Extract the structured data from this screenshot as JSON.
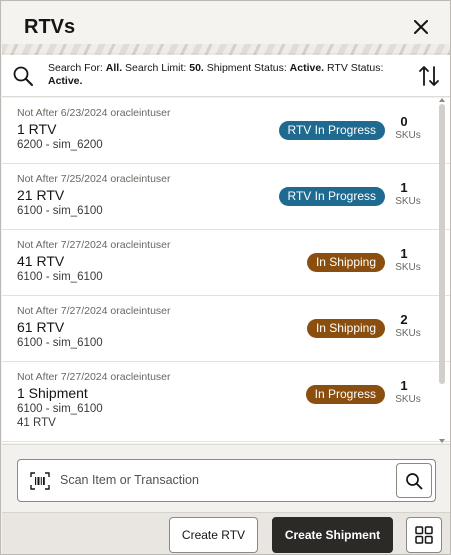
{
  "header": {
    "title": "RTVs"
  },
  "search_summary": {
    "prefix": "Search For:",
    "search_for": "All.",
    "limit_label": "Search Limit:",
    "limit": "50.",
    "shipment_status_label": "Shipment Status:",
    "shipment_status": "Active.",
    "rtv_status_label": "RTV Status:",
    "rtv_status": "Active."
  },
  "list": {
    "items": [
      {
        "date": "Not After 6/23/2024 oracleintuser",
        "name": "1 RTV",
        "store": "6200 - sim_6200",
        "extra": "",
        "status": "RTV In Progress",
        "status_color": "#1e6a91",
        "sku_count": "0",
        "sku_label": "SKUs"
      },
      {
        "date": "Not After 7/25/2024 oracleintuser",
        "name": "21 RTV",
        "store": "6100 - sim_6100",
        "extra": "",
        "status": "RTV In Progress",
        "status_color": "#1e6a91",
        "sku_count": "1",
        "sku_label": "SKUs"
      },
      {
        "date": "Not After 7/27/2024 oracleintuser",
        "name": "41 RTV",
        "store": "6100 - sim_6100",
        "extra": "",
        "status": "In Shipping",
        "status_color": "#8a4e0f",
        "sku_count": "1",
        "sku_label": "SKUs"
      },
      {
        "date": "Not After 7/27/2024 oracleintuser",
        "name": "61 RTV",
        "store": "6100 - sim_6100",
        "extra": "",
        "status": "In Shipping",
        "status_color": "#8a4e0f",
        "sku_count": "2",
        "sku_label": "SKUs"
      },
      {
        "date": "Not After 7/27/2024 oracleintuser",
        "name": "1 Shipment",
        "store": "6100 - sim_6100",
        "extra": "41 RTV",
        "status": "In Progress",
        "status_color": "#8a4e0f",
        "sku_count": "1",
        "sku_label": "SKUs"
      }
    ]
  },
  "scan": {
    "placeholder": "Scan Item or Transaction"
  },
  "footer": {
    "create_rtv_label": "Create RTV",
    "create_shipment_label": "Create Shipment"
  },
  "colors": {
    "primary_button": "#2c2a27",
    "badge_blue": "#1e6a91",
    "badge_brown": "#8a4e0f"
  },
  "icons": {
    "close": "close-icon",
    "search": "search-icon",
    "sort": "sort-icon",
    "barcode": "barcode-scan-icon",
    "grid": "grid-icon"
  }
}
